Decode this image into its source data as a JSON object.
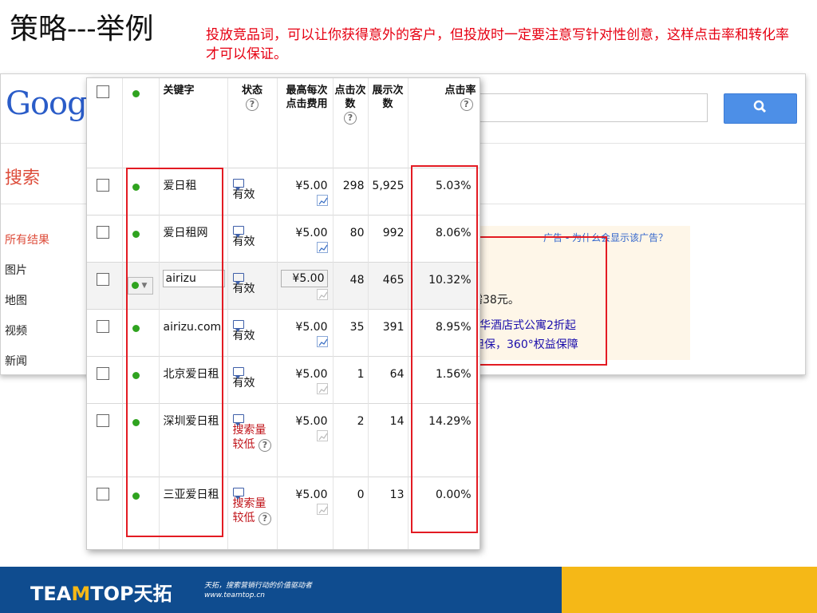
{
  "slide": {
    "title": "策略---举例",
    "subtitle": "投放竞品词，可以让你获得意外的客户，但投放时一定要注意写针对性创意，这样点击率和转化率才可以保证。"
  },
  "google": {
    "logo": "Goog",
    "search_section": "搜索",
    "nav": [
      "所有结果",
      "图片",
      "地图",
      "视频",
      "新闻"
    ],
    "ad_label": "广告 - 为什么会显示该广告？",
    "ad_line1": "需38元。",
    "ad_line2": "华酒店式公寓2折起",
    "ad_line3": "担保，360°权益保障"
  },
  "table": {
    "headers": {
      "keyword": "关键字",
      "status": "状态",
      "max_cpc": "最高每次点击费用",
      "clicks": "点击次数",
      "impressions": "展示次数",
      "ctr": "点击率"
    },
    "rows": [
      {
        "keyword": "爱日租",
        "status": "有效",
        "bid": "¥5.00",
        "clicks": "298",
        "impressions": "5,925",
        "ctr": "5.03%"
      },
      {
        "keyword": "爱日租网",
        "status": "有效",
        "bid": "¥5.00",
        "clicks": "80",
        "impressions": "992",
        "ctr": "8.06%"
      },
      {
        "keyword": "airizu",
        "status": "有效",
        "bid": "¥5.00",
        "clicks": "48",
        "impressions": "465",
        "ctr": "10.32%"
      },
      {
        "keyword": "airizu.com",
        "status": "有效",
        "bid": "¥5.00",
        "clicks": "35",
        "impressions": "391",
        "ctr": "8.95%"
      },
      {
        "keyword": "北京爱日租",
        "status": "有效",
        "bid": "¥5.00",
        "clicks": "1",
        "impressions": "64",
        "ctr": "1.56%"
      },
      {
        "keyword": "深圳爱日租",
        "status": "搜索量较低",
        "bid": "¥5.00",
        "clicks": "2",
        "impressions": "14",
        "ctr": "14.29%"
      },
      {
        "keyword": "三亚爱日租",
        "status": "搜索量较低",
        "bid": "¥5.00",
        "clicks": "0",
        "impressions": "13",
        "ctr": "0.00%"
      }
    ]
  },
  "footer": {
    "brand_pre": "TEA",
    "brand_m": "M",
    "brand_post": "TOP天拓",
    "tagline1": "天拓，搜索营销行动的价值驱动者",
    "tagline2": "www.teamtop.cn"
  },
  "colors": {
    "red": "#e31b23",
    "subtitle": "#e60012",
    "footer_blue": "#0f4c8f",
    "footer_yellow": "#f5b817",
    "status_dot": "#2fa31f"
  }
}
